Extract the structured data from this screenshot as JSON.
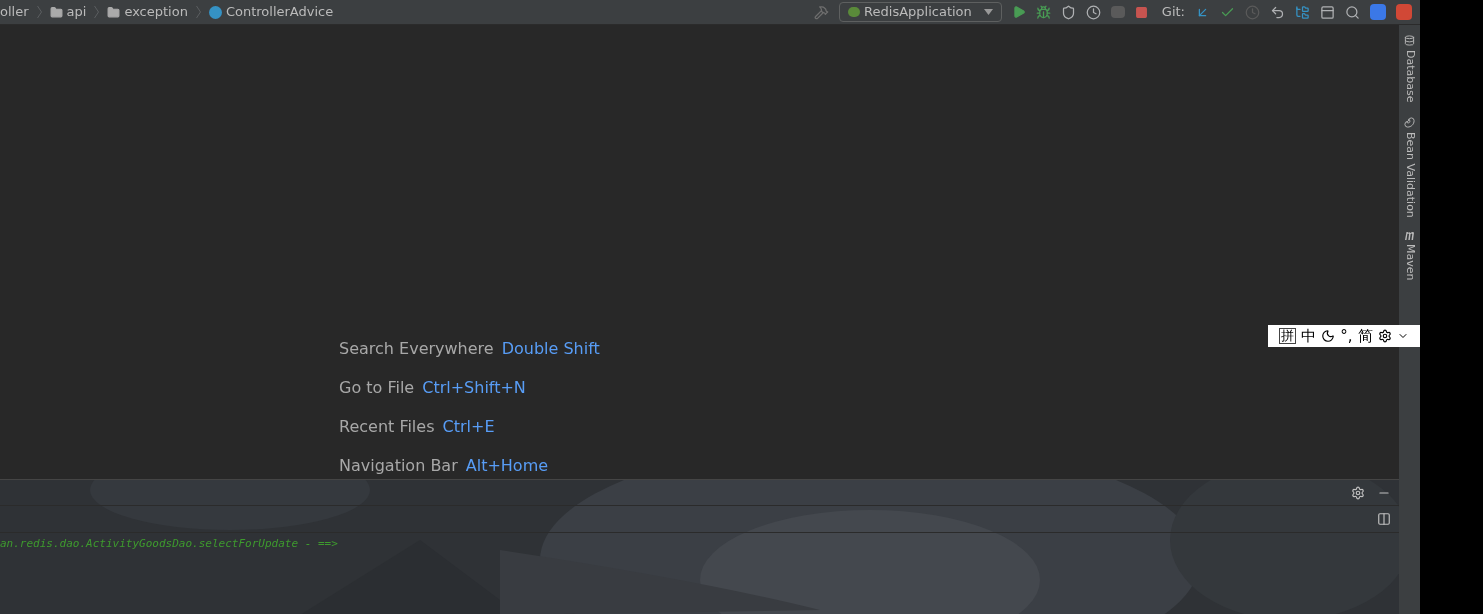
{
  "breadcrumbs": [
    {
      "kind": "text",
      "label": "oller"
    },
    {
      "kind": "folder",
      "label": "api"
    },
    {
      "kind": "folder",
      "label": "exception"
    },
    {
      "kind": "class",
      "label": "ControllerAdvice"
    }
  ],
  "run_config": {
    "label": "RedisApplication"
  },
  "git_label": "Git:",
  "tool_windows": [
    {
      "kind": "database",
      "label": "Database"
    },
    {
      "kind": "bean",
      "label": "Bean Validation"
    },
    {
      "kind": "maven",
      "label": "Maven"
    }
  ],
  "hints": [
    {
      "action": "Search Everywhere",
      "shortcut": "Double Shift"
    },
    {
      "action": "Go to File",
      "shortcut": "Ctrl+Shift+N"
    },
    {
      "action": "Recent Files",
      "shortcut": "Ctrl+E"
    },
    {
      "action": "Navigation Bar",
      "shortcut": "Alt+Home"
    }
  ],
  "console": {
    "lines": [
      "an.redis.dao.ActivityGoodsDao.selectForUpdate - ==>"
    ]
  },
  "ime": [
    {
      "kind": "boxed",
      "label": "拼"
    },
    {
      "kind": "text",
      "label": "中"
    },
    {
      "kind": "moon"
    },
    {
      "kind": "text",
      "label": "°,"
    },
    {
      "kind": "text",
      "label": "简"
    },
    {
      "kind": "gear"
    },
    {
      "kind": "more"
    }
  ]
}
